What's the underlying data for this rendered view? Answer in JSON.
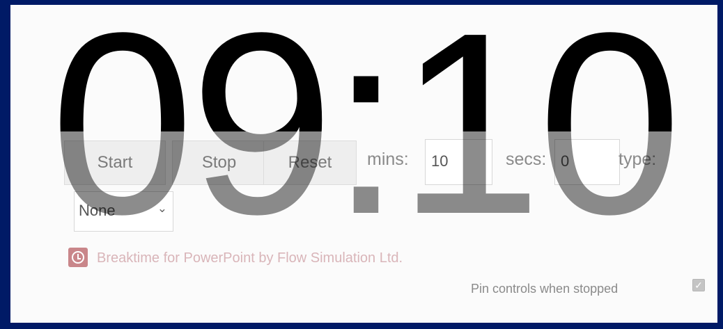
{
  "timer": {
    "display": "09:10"
  },
  "controls": {
    "start_label": "Start",
    "stop_label": "Stop",
    "reset_label": "Reset",
    "mins_label": "mins:",
    "mins_value": "10",
    "secs_label": "secs:",
    "secs_value": "0",
    "type_label": "type:",
    "type_selected": "None"
  },
  "footer": {
    "branding": "Breaktime for PowerPoint by Flow Simulation Ltd.",
    "pin_label": "Pin controls when stopped",
    "pin_checked": true
  },
  "colors": {
    "frame": "#001a66",
    "background": "#fbfbfb",
    "branding": "#d9b5b9",
    "icon": "#c9868a"
  },
  "icons": {
    "branding_icon": "clock-icon",
    "type_dropdown": "chevron-down-icon",
    "pin_checkbox": "checkbox-icon"
  }
}
